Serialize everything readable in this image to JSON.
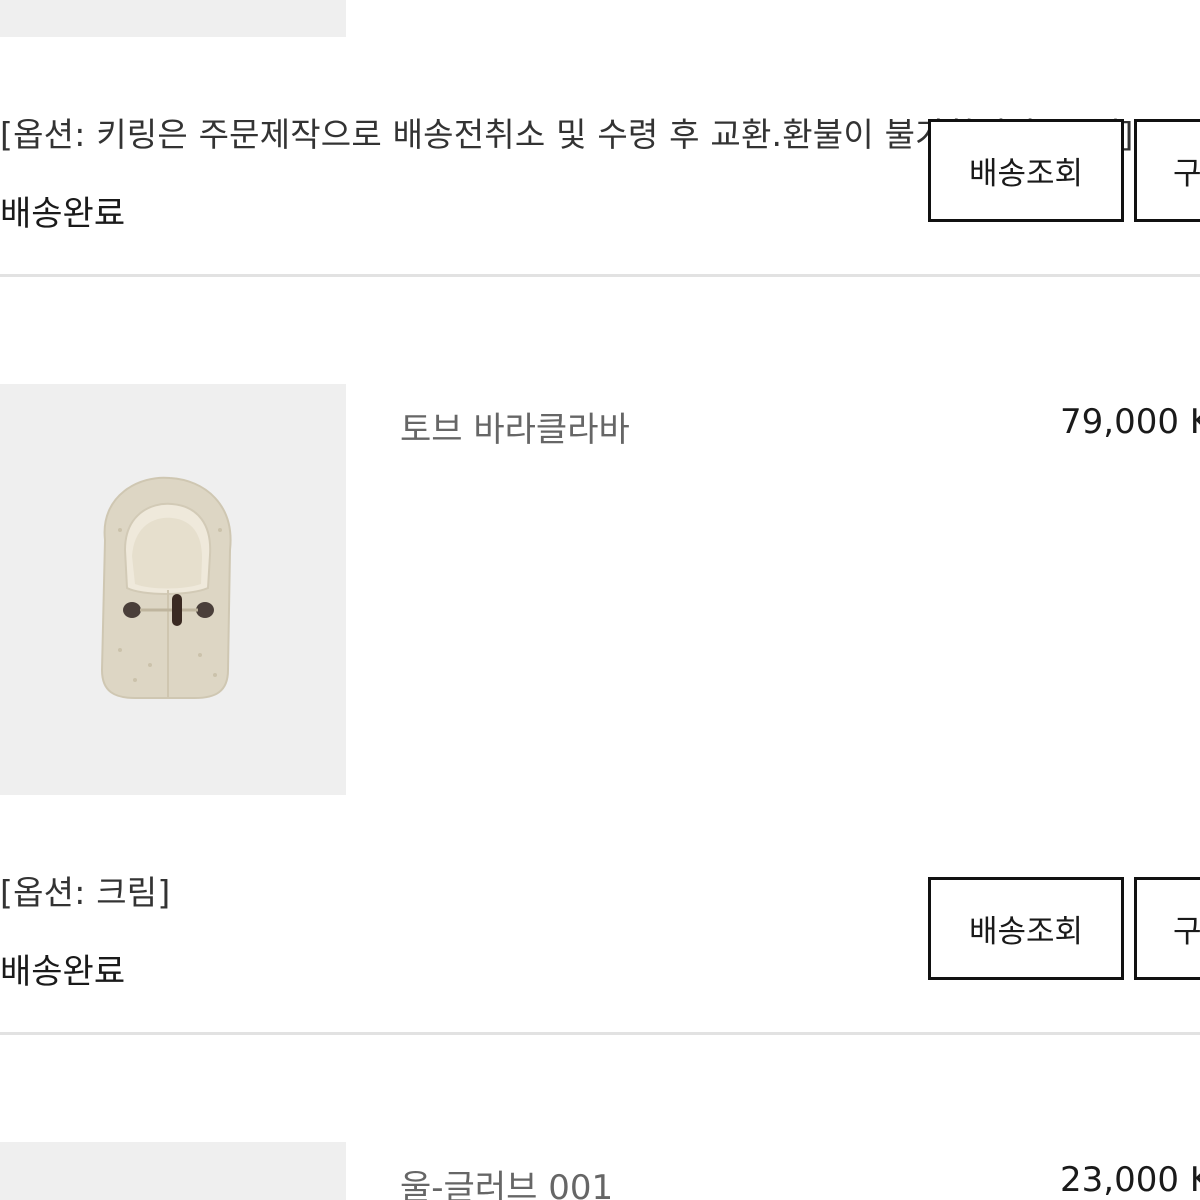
{
  "orders": [
    {
      "option": "[옵션: 키링은 주문제작으로 배송전취소 및 수령 후 교환.환불이 불가합니다./블랙]",
      "status": "배송완료",
      "buttons": {
        "track": "배송조회",
        "confirm": "구"
      }
    },
    {
      "name": "토브 바라클라바",
      "price": "79,000 K",
      "option": "[옵션: 크림]",
      "status": "배송완료",
      "image": "cream-fleece-balaclava",
      "buttons": {
        "track": "배송조회",
        "confirm": "구"
      }
    },
    {
      "name": "울-글러브 001",
      "price": "23,000 K"
    }
  ],
  "colors": {
    "thumb_bg": "#efefef",
    "divider": "#e2e2e2",
    "button_border": "#111111",
    "product_name": "#666666"
  }
}
